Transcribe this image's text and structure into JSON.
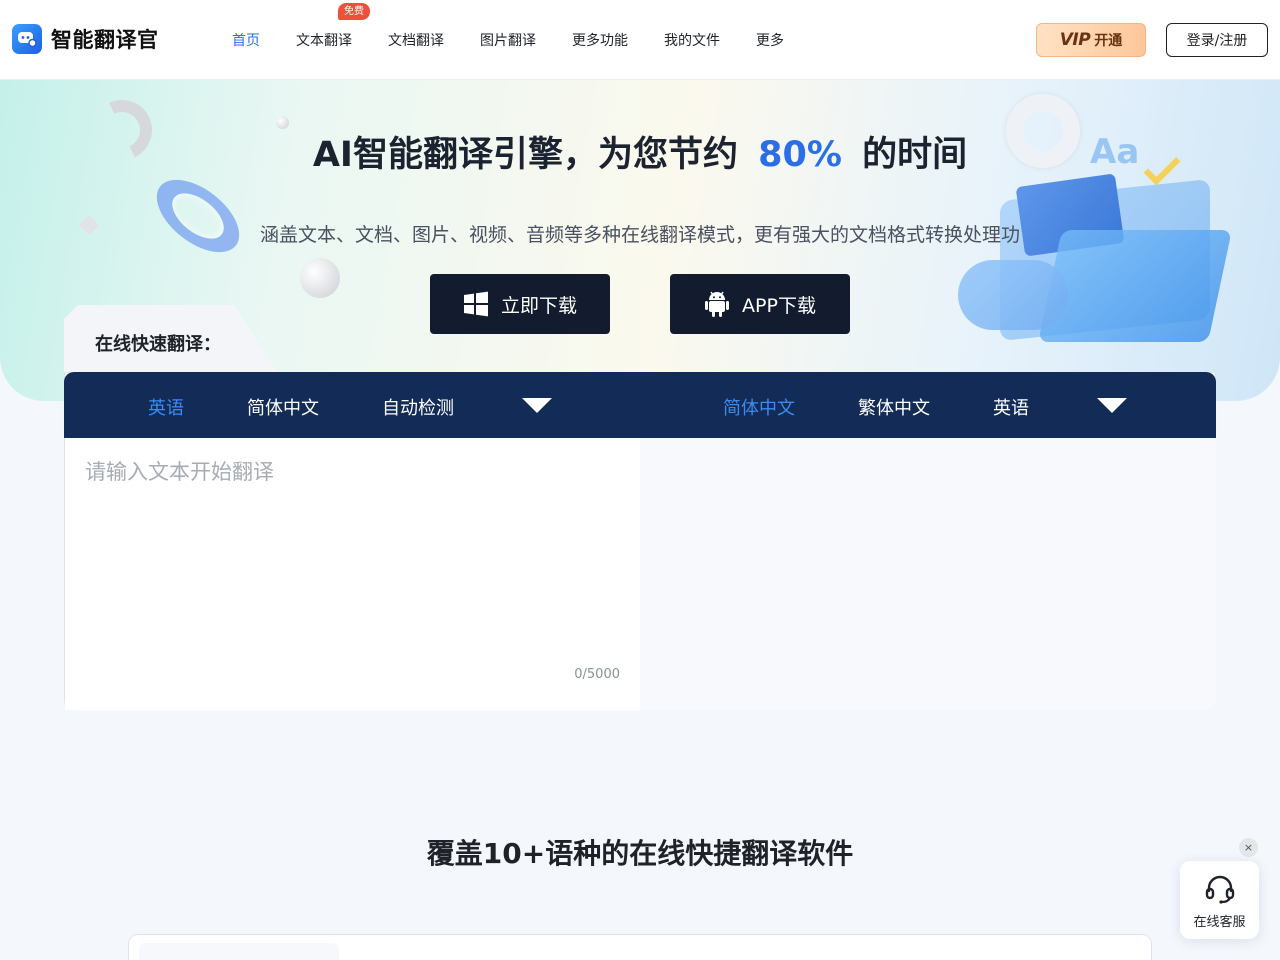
{
  "header": {
    "logo_text": "智能翻译官",
    "nav": [
      {
        "label": "首页",
        "active": true
      },
      {
        "label": "文本翻译",
        "badge": "免费"
      },
      {
        "label": "文档翻译"
      },
      {
        "label": "图片翻译"
      },
      {
        "label": "更多功能"
      },
      {
        "label": "我的文件"
      },
      {
        "label": "更多"
      }
    ],
    "vip_logo": "VIP",
    "vip_label": "开通",
    "login_label": "登录/注册"
  },
  "hero": {
    "title_prefix": "AI智能翻译引擎，为您节约",
    "title_accent": "80%",
    "title_suffix": "的时间",
    "subtitle": "涵盖文本、文档、图片、视频、音频等多种在线翻译模式，更有强大的文档格式转换处理功",
    "download_windows": "立即下载",
    "download_app": "APP下载",
    "deco_text": "Aa",
    "accent_color": "#2a6ee8"
  },
  "translator": {
    "tab_label": "在线快速翻译：",
    "source_langs": [
      "英语",
      "简体中文",
      "自动检测"
    ],
    "target_langs": [
      "简体中文",
      "繁体中文",
      "英语"
    ],
    "input_placeholder": "请输入文本开始翻译",
    "input_value": "",
    "counter": "0/5000",
    "bar_color": "#122b57"
  },
  "section": {
    "title": "覆盖10+语种的在线快捷翻译软件"
  },
  "customer_service": {
    "label": "在线客服",
    "close_glyph": "×",
    "icon": "headset-icon"
  }
}
